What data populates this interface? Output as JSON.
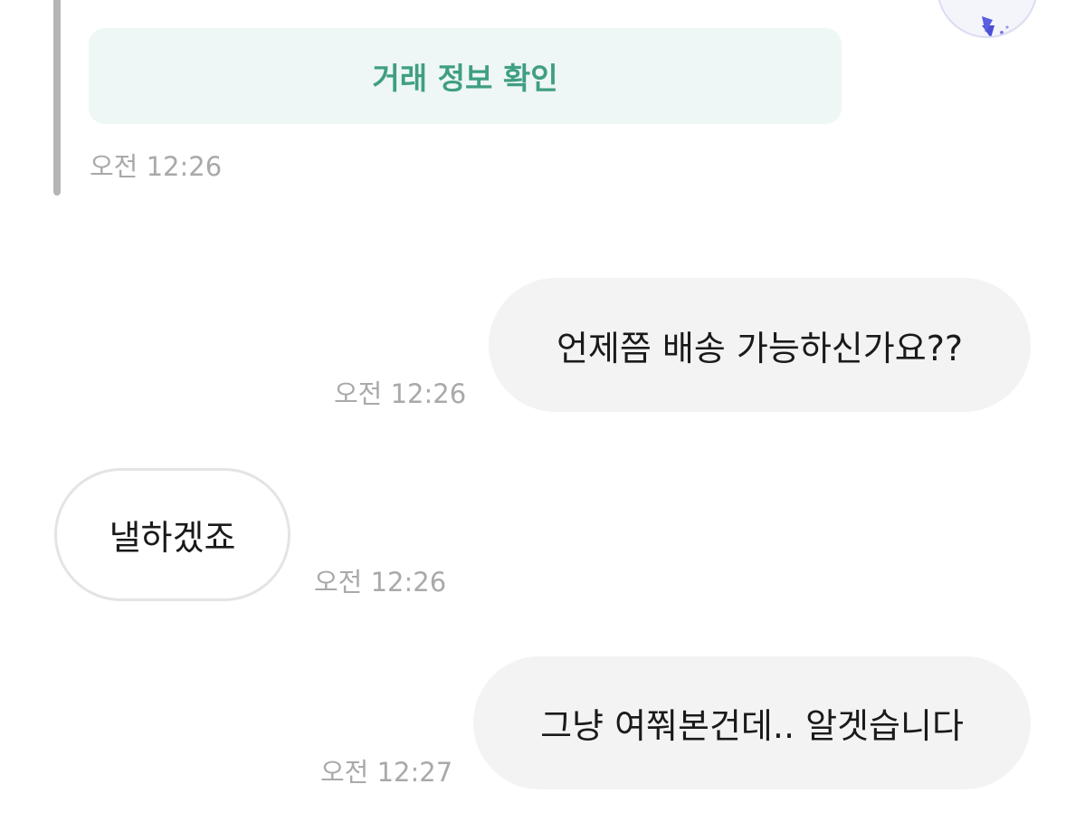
{
  "transaction_card": {
    "button_label": "거래 정보 확인",
    "time": "오전 12:26"
  },
  "messages": [
    {
      "direction": "outgoing",
      "text": "언제쯤 배송 가능하신가요??",
      "time": "오전 12:26"
    },
    {
      "direction": "incoming",
      "text": "낼하겠죠",
      "time": "오전 12:26"
    },
    {
      "direction": "outgoing",
      "text": "그냥 여쭤본건데.. 알겟습니다",
      "time": "오전 12:27"
    }
  ],
  "colors": {
    "accent_green": "#3f9e83",
    "card_bg": "#eef7f5",
    "outgoing_bubble": "#f3f3f3",
    "incoming_border": "#e4e4e4",
    "timestamp": "#a9a9a9",
    "avatar_icon": "#4b4fd6"
  },
  "icons": {
    "avatar": "profile-avatar-icon"
  }
}
